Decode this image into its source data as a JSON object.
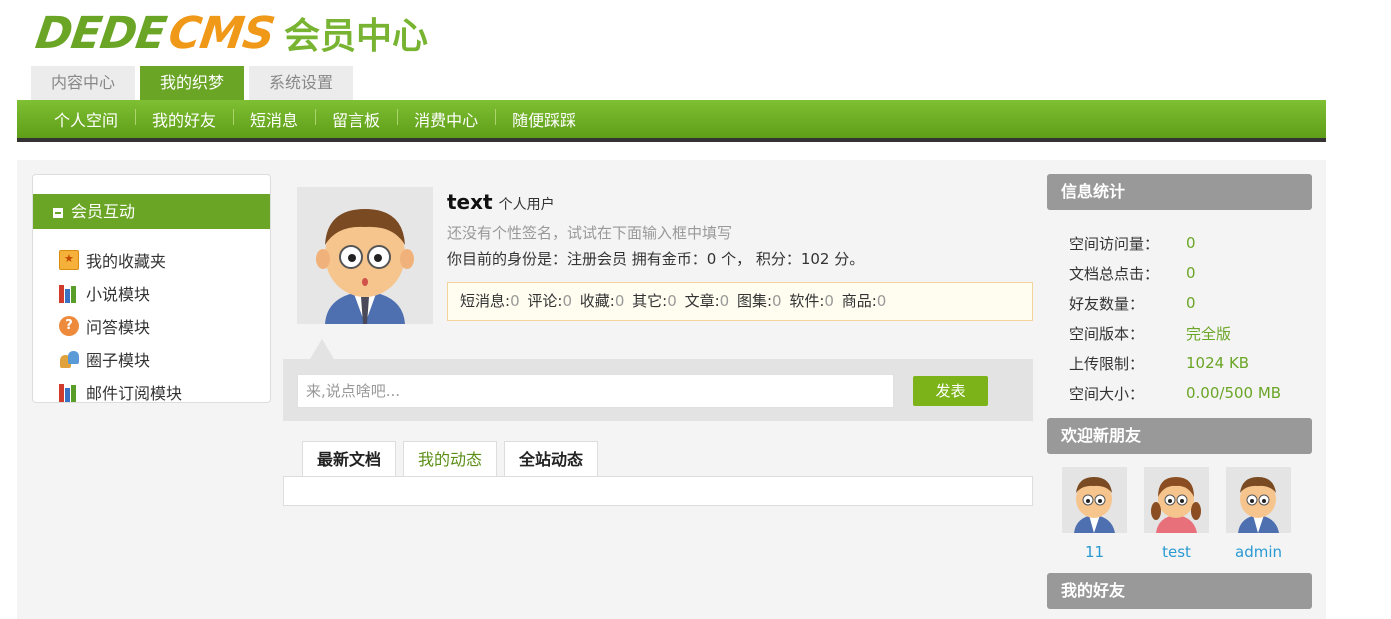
{
  "logo": {
    "dede": "DEDE",
    "cms": "CMS",
    "cn": "会员中心"
  },
  "top_tabs": [
    {
      "label": "内容中心"
    },
    {
      "label": "我的织梦"
    },
    {
      "label": "系统设置"
    }
  ],
  "nav": [
    {
      "label": "个人空间"
    },
    {
      "label": "我的好友"
    },
    {
      "label": "短消息"
    },
    {
      "label": "留言板"
    },
    {
      "label": "消费中心"
    },
    {
      "label": "随便踩踩"
    }
  ],
  "sidebar": {
    "title": "会员互动",
    "items": [
      {
        "label": "我的收藏夹",
        "icon": "favorites-folder-icon"
      },
      {
        "label": "小说模块",
        "icon": "books-icon"
      },
      {
        "label": "问答模块",
        "icon": "question-icon"
      },
      {
        "label": "圈子模块",
        "icon": "group-icon"
      },
      {
        "label": "邮件订阅模块",
        "icon": "books-icon"
      }
    ]
  },
  "profile": {
    "username": "text",
    "user_type": "个人用户",
    "signature": "还没有个性签名，试试在下面输入框中填写",
    "identity": "你目前的身份是：注册会员 拥有金币：0 个， 积分：102 分。",
    "stats": [
      {
        "label": "短消息:",
        "value": "0"
      },
      {
        "label": "评论:",
        "value": "0"
      },
      {
        "label": "收藏:",
        "value": "0"
      },
      {
        "label": "其它:",
        "value": "0"
      },
      {
        "label": "文章:",
        "value": "0"
      },
      {
        "label": "图集:",
        "value": "0"
      },
      {
        "label": "软件:",
        "value": "0"
      },
      {
        "label": "商品:",
        "value": "0"
      }
    ]
  },
  "post": {
    "placeholder": "来,说点啥吧...",
    "button": "发表"
  },
  "feed_tabs": [
    {
      "label": "最新文档"
    },
    {
      "label": "我的动态"
    },
    {
      "label": "全站动态"
    }
  ],
  "right": {
    "info_title": "信息统计",
    "info": [
      {
        "key": "空间访问量：",
        "value": "0"
      },
      {
        "key": "文档总点击：",
        "value": "0"
      },
      {
        "key": "好友数量：",
        "value": "0"
      },
      {
        "key": "空间版本：",
        "value": "完全版"
      },
      {
        "key": "上传限制：",
        "value": "1024 KB"
      },
      {
        "key": "空间大小：",
        "value": "0.00/500 MB"
      }
    ],
    "new_friends_title": "欢迎新朋友",
    "new_friends": [
      {
        "name": "11"
      },
      {
        "name": "test"
      },
      {
        "name": "admin"
      }
    ],
    "my_friends_title": "我的好友"
  },
  "colors": {
    "accent": "#6aa526",
    "orange": "#f09818",
    "link": "#2a9ad2"
  }
}
